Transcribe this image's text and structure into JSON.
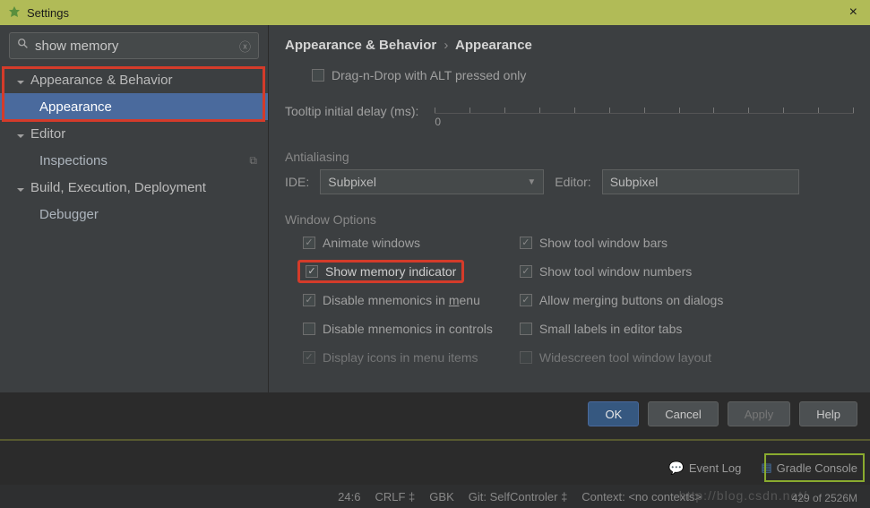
{
  "titlebar": {
    "title": "Settings",
    "close": "×"
  },
  "search": {
    "value": "show memory",
    "clear": "ⓧ"
  },
  "tree": {
    "appearance_behavior": "Appearance & Behavior",
    "appearance": "Appearance",
    "editor": "Editor",
    "inspections": "Inspections",
    "build": "Build, Execution, Deployment",
    "debugger": "Debugger"
  },
  "breadcrumb": {
    "root": "Appearance & Behavior",
    "sep": "›",
    "leaf": "Appearance"
  },
  "opts": {
    "drag_drop": "Drag-n-Drop with ALT pressed only",
    "tooltip_label": "Tooltip initial delay (ms):",
    "tooltip_zero": "0",
    "aa_section": "Antialiasing",
    "ide_label": "IDE:",
    "ide_value": "Subpixel",
    "editor_label": "Editor:",
    "editor_value": "Subpixel",
    "win_section": "Window Options",
    "animate": "Animate windows",
    "show_mem": "Show memory indicator",
    "disable_mn_menu_pre": "Disable mnemonics in ",
    "disable_mn_menu_u": "m",
    "disable_mn_menu_post": "enu",
    "disable_mn_ctrl": "Disable mnemonics in controls",
    "display_icons": "Display icons in menu items",
    "show_bars": "Show tool window bars",
    "show_numbers": "Show tool window numbers",
    "allow_merge": "Allow merging buttons on dialogs",
    "small_labels": "Small labels in editor tabs",
    "widescreen": "Widescreen tool window layout"
  },
  "buttons": {
    "ok": "OK",
    "cancel": "Cancel",
    "apply": "Apply",
    "help": "Help"
  },
  "bottom": {
    "event_log": "Event Log",
    "gradle": "Gradle Console"
  },
  "status": {
    "pos": "24:6",
    "crlf": "CRLF",
    "enc": "GBK",
    "git": "Git: SelfControler",
    "ctx": "Context: <no contexts>",
    "watermark": "http://blog.csdn.net/",
    "mem": "429 of 2526M"
  }
}
